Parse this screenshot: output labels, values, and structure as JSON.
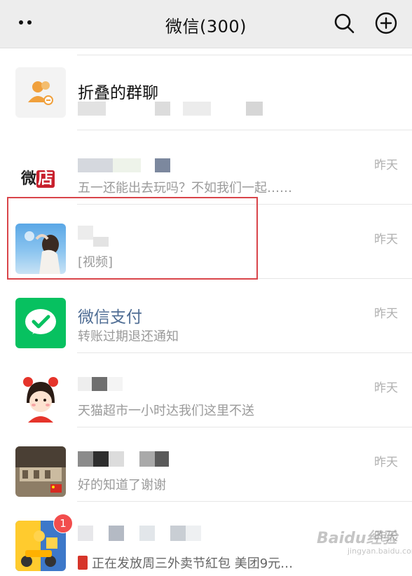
{
  "header": {
    "title": "微信(300)",
    "more_icon": "more-dots-icon",
    "search_icon": "search-icon",
    "add_icon": "plus-circle-icon"
  },
  "chats": [
    {
      "name": "折叠的群聊",
      "preview": "",
      "time": "",
      "avatar_icon": "folded-group-icon"
    },
    {
      "name": "",
      "preview": "五一还能出去玩吗？不如我们一起……",
      "time": "昨天",
      "avatar_text": "微店",
      "avatar_icon": "weidian-logo"
    },
    {
      "name": "",
      "preview": "[视频]",
      "time": "昨天",
      "avatar_icon": "photo-avatar"
    },
    {
      "name": "微信支付",
      "preview": "转账过期退还通知",
      "time": "昨天",
      "avatar_icon": "wechat-pay-icon"
    },
    {
      "name": "",
      "preview": "天猫超市一小时达我们这里不送",
      "time": "昨天",
      "avatar_icon": "cartoon-girl-avatar"
    },
    {
      "name": "",
      "preview": "好的知道了谢谢",
      "time": "昨天",
      "avatar_icon": "store-photo-avatar"
    },
    {
      "name": "",
      "preview": "正在发放周三外卖节紅包 美团9元…",
      "time": "昨天",
      "avatar_icon": "delivery-avatar",
      "badge": "1"
    }
  ],
  "watermark": {
    "text": "Baidu经验",
    "sub": "jingyan.baidu.com"
  },
  "colors": {
    "accent_red": "#d9454a",
    "wechat_green": "#07c160",
    "name_blue": "#4f6d94"
  }
}
